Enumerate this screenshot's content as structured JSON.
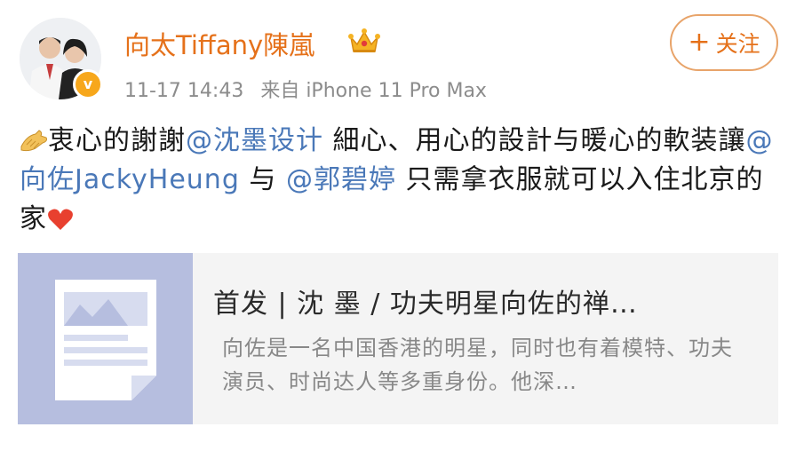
{
  "post": {
    "author": {
      "name": "向太Tiffany陳嵐",
      "badge_icon": "crown-icon",
      "verified_icon": "verified-badge-icon"
    },
    "timestamp": "11-17 14:43",
    "source": "来自 iPhone 11 Pro Max",
    "follow_button": {
      "icon": "+",
      "label": "关注"
    },
    "text": {
      "part1": "衷心的謝謝",
      "mention1": "@沈墨设计",
      "part2": " 細心、用心的設計与暖心的軟装讓",
      "mention2": "@向佐JackyHeung",
      "part3": " 与 ",
      "mention3": "@郭碧婷",
      "part4": " 只需拿衣服就可以入住北京的家"
    },
    "link_card": {
      "title": "首发 | 沈 墨 / 功夫明星向佐的禅…",
      "description": "向佐是一名中国香港的明星，同时也有着模特、功夫演员、时尚达人等多重身份。他深…"
    }
  },
  "colors": {
    "username": "#e5711a",
    "mention": "#4a78b8",
    "meta": "#8c8c8c",
    "card_bg": "#f4f4f4",
    "thumb_bg": "#b6bedf"
  }
}
